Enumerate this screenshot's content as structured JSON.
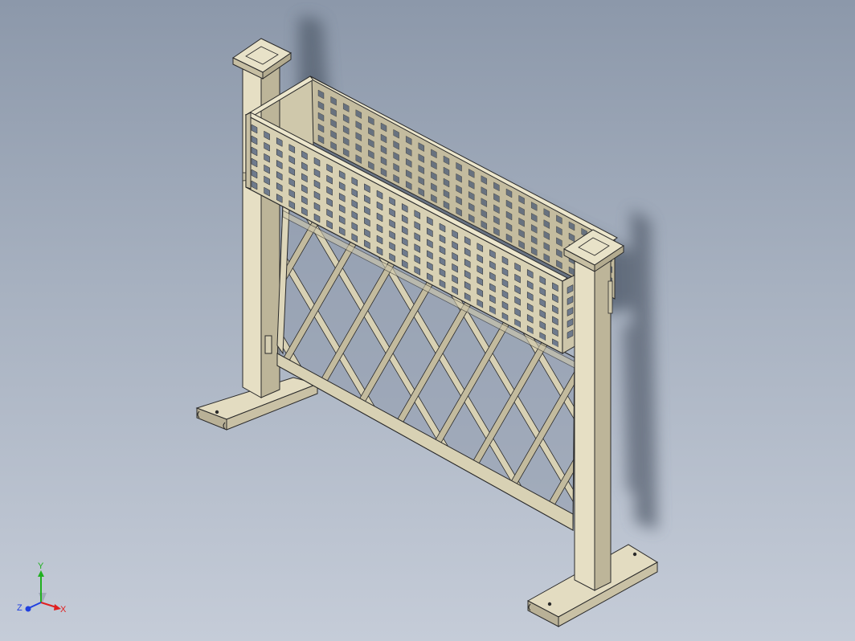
{
  "viewport": {
    "background_top": "#8c98aa",
    "background_bottom": "#c5ccd8"
  },
  "model": {
    "body_color": "#d8d1b4",
    "body_shade": "#b9b197",
    "edge_color": "#2a2a2a",
    "shadow_color": "#4a5568"
  },
  "triad": {
    "x_label": "X",
    "y_label": "Y",
    "z_label": "Z",
    "x_color": "#e02020",
    "y_color": "#20b020",
    "z_color": "#2040e0"
  }
}
